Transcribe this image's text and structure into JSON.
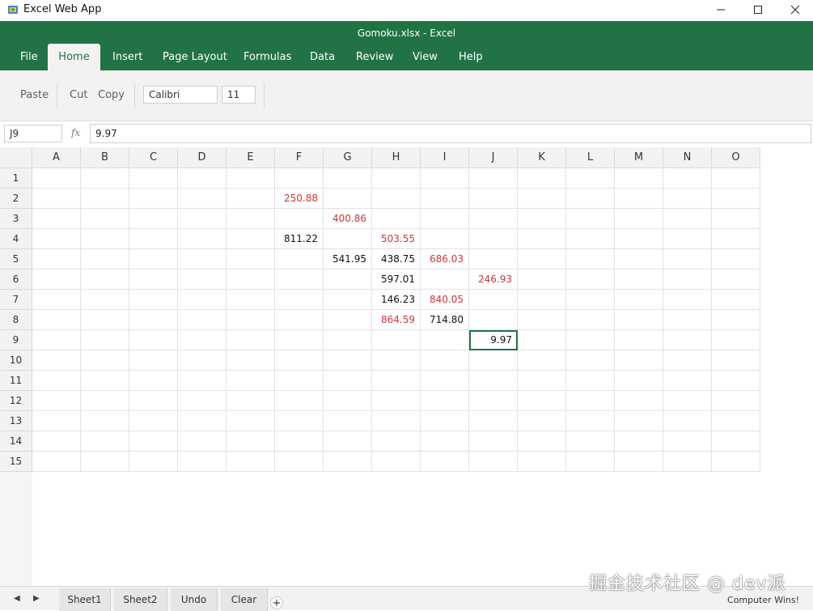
{
  "os": {
    "app_title": "Excel Web App",
    "minimize_glyph": "—",
    "maximize_glyph": "☐",
    "close_glyph": "✕"
  },
  "header": {
    "doc_title": "Gomoku.xlsx - Excel",
    "tabs": [
      "File",
      "Home",
      "Insert",
      "Page Layout",
      "Formulas",
      "Data",
      "Review",
      "View",
      "Help"
    ],
    "active_tab": "Home",
    "accent_color": "#217346"
  },
  "toolbar": {
    "paste": "Paste",
    "cut": "Cut",
    "copy": "Copy",
    "font_name": "Calibri",
    "font_size": "11"
  },
  "formula_bar": {
    "name_box": "J9",
    "fx": "fx",
    "value": "9.97"
  },
  "grid": {
    "columns": [
      "A",
      "B",
      "C",
      "D",
      "E",
      "F",
      "G",
      "H",
      "I",
      "J",
      "K",
      "L",
      "M",
      "N",
      "O"
    ],
    "rows": [
      "1",
      "2",
      "3",
      "4",
      "5",
      "6",
      "7",
      "8",
      "9",
      "10",
      "11",
      "12",
      "13",
      "14",
      "15"
    ],
    "selected": "J9",
    "cells": {
      "F2": {
        "v": "250.88",
        "c": "red"
      },
      "G3": {
        "v": "400.86",
        "c": "red"
      },
      "F4": {
        "v": "811.22",
        "c": "black"
      },
      "H4": {
        "v": "503.55",
        "c": "red"
      },
      "G5": {
        "v": "541.95",
        "c": "black"
      },
      "H5": {
        "v": "438.75",
        "c": "black"
      },
      "I5": {
        "v": "686.03",
        "c": "red"
      },
      "H6": {
        "v": "597.01",
        "c": "black"
      },
      "J6": {
        "v": "246.93",
        "c": "red"
      },
      "H7": {
        "v": "146.23",
        "c": "black"
      },
      "I7": {
        "v": "840.05",
        "c": "red"
      },
      "H8": {
        "v": "864.59",
        "c": "red"
      },
      "I8": {
        "v": "714.80",
        "c": "black"
      },
      "J9": {
        "v": "9.97",
        "c": "black"
      }
    },
    "red_color": "#d13438"
  },
  "sheetbar": {
    "prev": "◀",
    "next": "▶",
    "tabs": [
      "Sheet1",
      "Sheet2",
      "Undo",
      "Clear"
    ],
    "add": "+",
    "status": "Computer Wins!"
  },
  "watermark": "掘金技术社区 @ dev派"
}
